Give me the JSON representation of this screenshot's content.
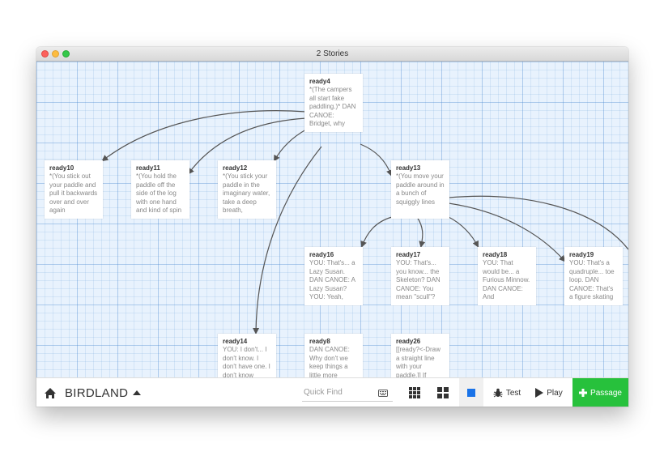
{
  "window": {
    "title": "2 Stories"
  },
  "passages": [
    {
      "id": "ready4",
      "title": "ready4",
      "excerpt": "*(The campers all start fake paddling.)* DAN CANOE: Bridget, why"
    },
    {
      "id": "ready10",
      "title": "ready10",
      "excerpt": "*(You stick out your paddle and pull it backwards over and over again"
    },
    {
      "id": "ready11",
      "title": "ready11",
      "excerpt": "*(You hold the paddle off the side of the log with one hand and kind of spin"
    },
    {
      "id": "ready12",
      "title": "ready12",
      "excerpt": "*(You stick your paddle in the imaginary water, take a deep breath,"
    },
    {
      "id": "ready13",
      "title": "ready13",
      "excerpt": "*(You move your paddle around in a bunch of squiggly lines"
    },
    {
      "id": "ready16",
      "title": "ready16",
      "excerpt": "YOU: That's... a Lazy Susan. DAN CANOE: A Lazy Susan? YOU: Yeah,"
    },
    {
      "id": "ready17",
      "title": "ready17",
      "excerpt": "YOU: That's... you know... the Skeleton? DAN CANOE: You mean \"scull\"?"
    },
    {
      "id": "ready18",
      "title": "ready18",
      "excerpt": "YOU: That would be... a Furious Minnow. DAN CANOE: And"
    },
    {
      "id": "ready19",
      "title": "ready19",
      "excerpt": "YOU: That's a quadruple... toe loop. DAN CANOE: That's a figure skating"
    },
    {
      "id": "ready14",
      "title": "ready14",
      "excerpt": "YOU: I don't... I don't know. I don't have one. I don't know"
    },
    {
      "id": "ready8",
      "title": "ready8",
      "excerpt": "DAN CANOE: Why don't we keep things a little more"
    },
    {
      "id": "ready26",
      "title": "ready26",
      "excerpt": "[[ready?<-Draw a straight line with your paddle.]] If"
    }
  ],
  "toolbar": {
    "story_name": "BIRDLAND",
    "quick_find_placeholder": "Quick Find",
    "test_label": "Test",
    "play_label": "Play",
    "passage_label": "Passage",
    "accent_color": "#27c13c",
    "highlight_color": "#1a73e8"
  },
  "icons": [
    "home-icon",
    "caret-up-icon",
    "keyboard-icon",
    "grid-nine-icon",
    "grid-four-icon",
    "square-icon",
    "bug-icon",
    "play-icon",
    "plus-icon"
  ]
}
